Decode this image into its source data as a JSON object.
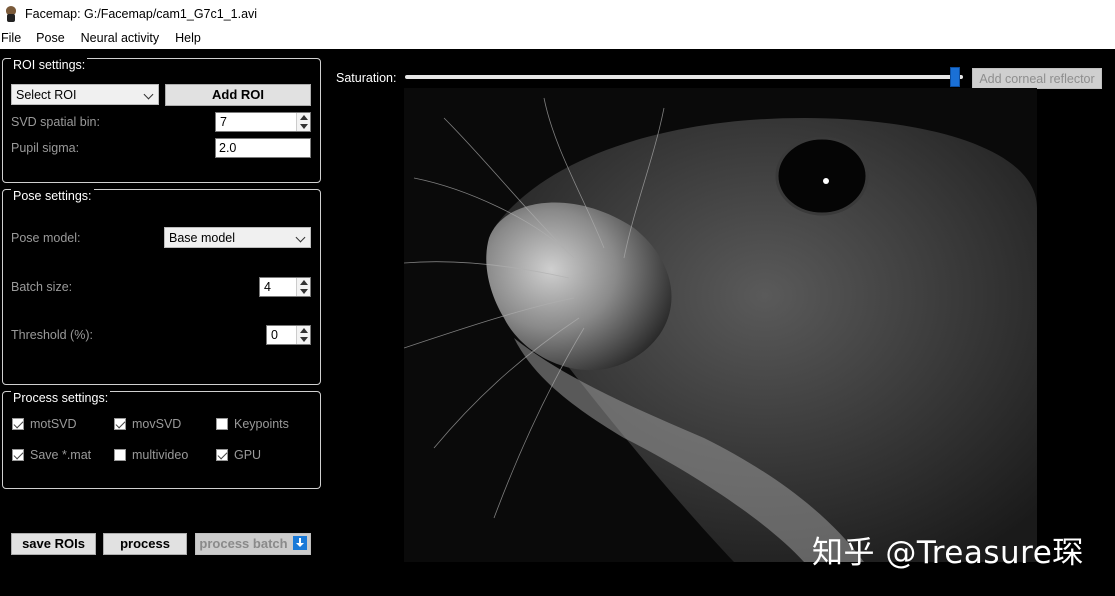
{
  "window": {
    "title": "Facemap: G:/Facemap/cam1_G7c1_1.avi"
  },
  "menu": [
    "File",
    "Pose",
    "Neural activity",
    "Help"
  ],
  "roi_settings": {
    "legend": "ROI settings:",
    "select_roi": "Select ROI",
    "add_roi_button": "Add ROI",
    "svd_label": "SVD spatial bin:",
    "svd_value": "7",
    "pupil_label": "Pupil sigma:",
    "pupil_value": "2.0"
  },
  "pose_settings": {
    "legend": "Pose settings:",
    "model_label": "Pose model:",
    "model_value": "Base model",
    "batch_label": "Batch size:",
    "batch_value": "4",
    "threshold_label": "Threshold (%):",
    "threshold_value": "0"
  },
  "process_settings": {
    "legend": "Process settings:",
    "checks": [
      {
        "label": "motSVD",
        "checked": true
      },
      {
        "label": "movSVD",
        "checked": true
      },
      {
        "label": "Keypoints",
        "checked": false
      },
      {
        "label": "Save *.mat",
        "checked": true
      },
      {
        "label": "multivideo",
        "checked": false
      },
      {
        "label": "GPU",
        "checked": true
      }
    ]
  },
  "bottom_buttons": {
    "save_rois": "save ROIs",
    "process": "process",
    "process_batch": "process batch"
  },
  "viewer": {
    "saturation_label": "Saturation:",
    "saturation_level": 0.985,
    "corneal_button": "Add corneal reflector",
    "watermark": "知乎 @Treasure琛"
  },
  "colors": {
    "accent": "#1a70d6",
    "background": "#000000"
  }
}
